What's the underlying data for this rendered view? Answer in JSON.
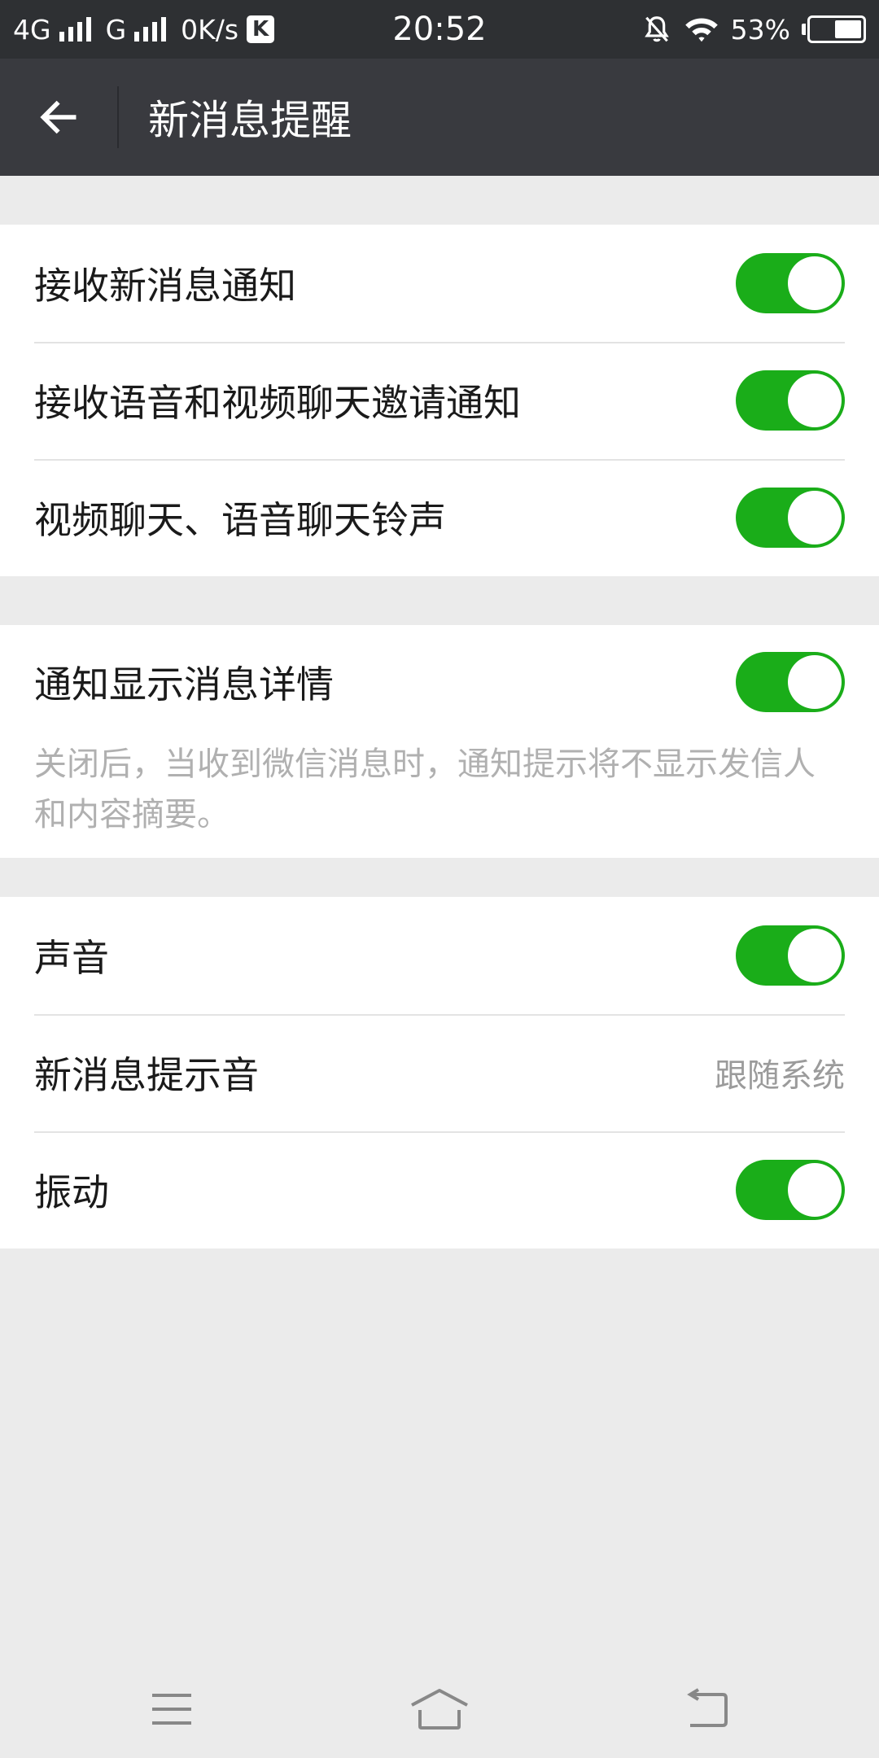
{
  "status_bar": {
    "network_1": "4G",
    "network_2": "G",
    "speed": "0K/s",
    "app_badge": "K",
    "time": "20:52",
    "battery": "53%",
    "battery_level": 0.53,
    "icons": [
      "signal-icon",
      "k-app-icon",
      "alarm-off-icon",
      "wifi-icon",
      "battery-icon"
    ]
  },
  "app_bar": {
    "title": "新消息提醒",
    "back_icon": "arrow-left-icon"
  },
  "sections": [
    {
      "rows": [
        {
          "label": "接收新消息通知",
          "toggle": true
        },
        {
          "label": "接收语音和视频聊天邀请通知",
          "toggle": true
        },
        {
          "label": "视频聊天、语音聊天铃声",
          "toggle": true
        }
      ]
    },
    {
      "rows": [
        {
          "label": "通知显示消息详情",
          "toggle": true
        }
      ],
      "description": "关闭后，当收到微信消息时，通知提示将不显示发信人和内容摘要。"
    },
    {
      "rows": [
        {
          "label": "声音",
          "toggle": true
        },
        {
          "label": "新消息提示音",
          "value": "跟随系统"
        },
        {
          "label": "振动",
          "toggle": true
        }
      ]
    }
  ],
  "nav_bar": {
    "icons": [
      "menu-icon",
      "home-icon",
      "back-icon"
    ]
  },
  "colors": {
    "accent": "#1aad19",
    "app_bar": "#393a3f",
    "status_bar": "#2e3033",
    "background": "#ebebeb"
  }
}
